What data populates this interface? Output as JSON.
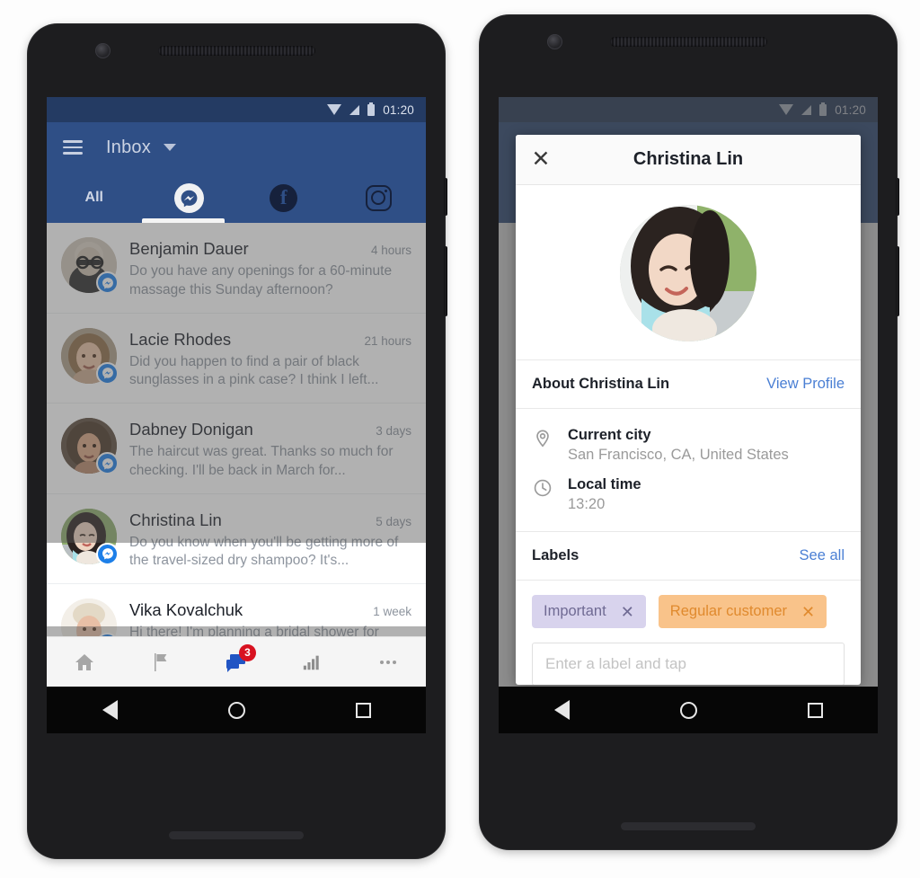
{
  "left_phone": {
    "status_bar": {
      "time": "01:20",
      "icons": [
        "wifi-icon",
        "signal-icon",
        "battery-icon"
      ]
    },
    "app_bar": {
      "menu_icon": "hamburger-icon",
      "title": "Inbox",
      "caret_icon": "chevron-down-icon"
    },
    "tabs": [
      {
        "label": "All",
        "type": "text",
        "selected": false
      },
      {
        "label": "",
        "type": "messenger-icon",
        "selected": true
      },
      {
        "label": "",
        "type": "facebook-icon",
        "selected": false
      },
      {
        "label": "",
        "type": "instagram-icon",
        "selected": false
      }
    ],
    "messages": [
      {
        "name": "Benjamin Dauer",
        "time": "4 hours",
        "snippet": "Do you have any openings for a 60-minute massage this Sunday afternoon?",
        "selected": false
      },
      {
        "name": "Lacie Rhodes",
        "time": "21 hours",
        "snippet": "Did you happen to find a pair of black sunglasses in a pink case? I think I left...",
        "selected": false
      },
      {
        "name": "Dabney Donigan",
        "time": "3 days",
        "snippet": "The haircut was great. Thanks so much for checking. I'll be back in March for...",
        "selected": false
      },
      {
        "name": "Christina Lin",
        "time": "5 days",
        "snippet": "Do you know when you'll be getting more of the travel-sized dry shampoo? It's...",
        "selected": true
      },
      {
        "name": "Vika Kovalchuk",
        "time": "1 week",
        "snippet": "Hi there! I'm planning a bridal shower for",
        "selected": false
      }
    ],
    "bottom_nav": [
      {
        "icon": "home-icon",
        "active": false,
        "badge": ""
      },
      {
        "icon": "flag-icon",
        "active": false,
        "badge": ""
      },
      {
        "icon": "messages-icon",
        "active": true,
        "badge": "3"
      },
      {
        "icon": "insights-bar-chart-icon",
        "active": false,
        "badge": ""
      },
      {
        "icon": "more-ellipsis-icon",
        "active": false,
        "badge": ""
      }
    ],
    "android_nav": [
      "back-icon",
      "home-icon",
      "recents-icon"
    ]
  },
  "right_phone": {
    "status_bar": {
      "time": "01:20",
      "icons": [
        "wifi-icon",
        "signal-icon",
        "battery-icon"
      ]
    },
    "dialog": {
      "close_icon": "close-icon",
      "title": "Christina Lin",
      "avatar_name": "profile-photo",
      "about": {
        "heading": "About Christina Lin",
        "link": "View Profile",
        "rows": [
          {
            "icon": "location-pin-icon",
            "label": "Current city",
            "value": "San Francisco, CA, United States"
          },
          {
            "icon": "clock-icon",
            "label": "Local time",
            "value": "13:20"
          }
        ]
      },
      "labels": {
        "heading": "Labels",
        "link": "See all",
        "chips": [
          {
            "text": "Important",
            "bg": "#d8d3ed",
            "fg": "#6f6a93",
            "remove_icon": "remove-label-icon"
          },
          {
            "text": "Regular customer",
            "bg": "#f9c38a",
            "fg": "#e08a2e",
            "remove_icon": "remove-label-icon"
          }
        ],
        "input_placeholder": "Enter a label and tap"
      }
    },
    "android_nav": [
      "back-icon",
      "home-icon",
      "recents-icon"
    ]
  },
  "colors": {
    "app_bar_blue": "#2f4f86",
    "status_bar_blue": "#243b63",
    "messenger_blue": "#1d7fe8",
    "link_blue": "#4a7fd4",
    "badge_red": "#d81220"
  }
}
